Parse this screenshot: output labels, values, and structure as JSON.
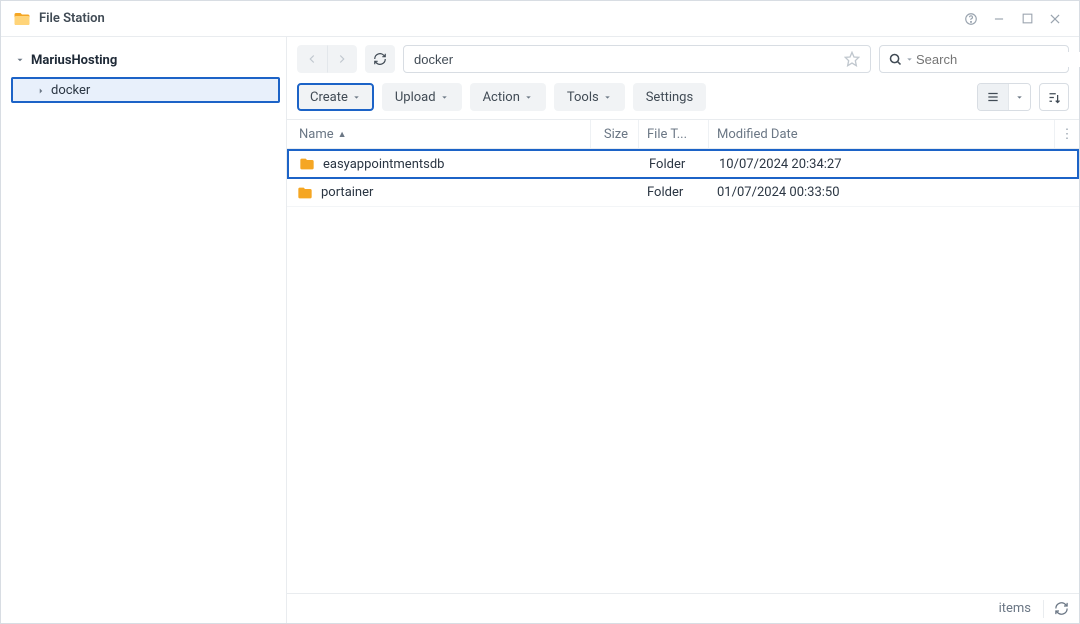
{
  "app": {
    "title": "File Station"
  },
  "sidebar": {
    "root": "MariusHosting",
    "items": [
      {
        "label": "docker"
      }
    ]
  },
  "path": {
    "value": "docker"
  },
  "search": {
    "placeholder": "Search"
  },
  "toolbar": {
    "create": "Create",
    "upload": "Upload",
    "action": "Action",
    "tools": "Tools",
    "settings": "Settings"
  },
  "columns": {
    "name": "Name",
    "size": "Size",
    "type": "File T...",
    "date": "Modified Date"
  },
  "rows": [
    {
      "name": "easyappointmentsdb",
      "type": "Folder",
      "date": "10/07/2024 20:34:27",
      "selected": true
    },
    {
      "name": "portainer",
      "type": "Folder",
      "date": "01/07/2024 00:33:50",
      "selected": false
    }
  ],
  "status": {
    "items_label": "items"
  }
}
